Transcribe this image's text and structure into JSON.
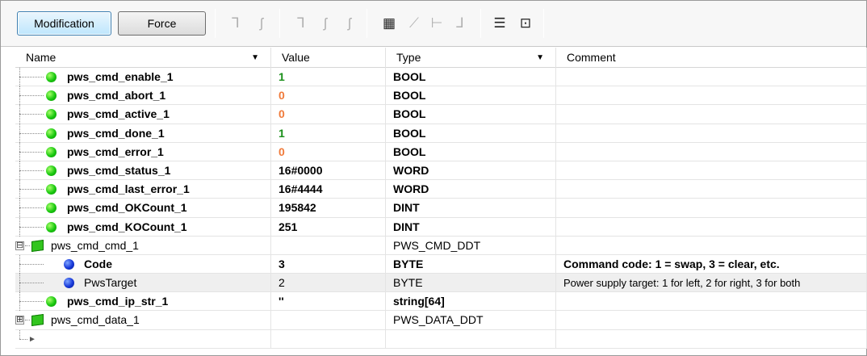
{
  "toolbar": {
    "modification_label": "Modification",
    "force_label": "Force"
  },
  "columns": {
    "name": "Name",
    "value": "Value",
    "type": "Type",
    "comment": "Comment"
  },
  "rows": [
    {
      "name": "pws_cmd_enable_1",
      "value": "1",
      "type": "BOOL",
      "comment": ""
    },
    {
      "name": "pws_cmd_abort_1",
      "value": "0",
      "type": "BOOL",
      "comment": ""
    },
    {
      "name": "pws_cmd_active_1",
      "value": "0",
      "type": "BOOL",
      "comment": ""
    },
    {
      "name": "pws_cmd_done_1",
      "value": "1",
      "type": "BOOL",
      "comment": ""
    },
    {
      "name": "pws_cmd_error_1",
      "value": "0",
      "type": "BOOL",
      "comment": ""
    },
    {
      "name": "pws_cmd_status_1",
      "value": "16#0000",
      "type": "WORD",
      "comment": ""
    },
    {
      "name": "pws_cmd_last_error_1",
      "value": "16#4444",
      "type": "WORD",
      "comment": ""
    },
    {
      "name": "pws_cmd_OKCount_1",
      "value": "195842",
      "type": "DINT",
      "comment": ""
    },
    {
      "name": "pws_cmd_KOCount_1",
      "value": "251",
      "type": "DINT",
      "comment": ""
    },
    {
      "name": "pws_cmd_cmd_1",
      "value": "",
      "type": "PWS_CMD_DDT",
      "comment": "",
      "expander": "⊟"
    },
    {
      "name": "Code",
      "value": "3",
      "type": "BYTE",
      "comment": "Command code: 1 = swap, 3 = clear, etc."
    },
    {
      "name": "PwsTarget",
      "value": "2",
      "type": "BYTE",
      "comment": "Power supply target: 1 for left, 2 for right, 3 for both"
    },
    {
      "name": "pws_cmd_ip_str_1",
      "value": "''",
      "type": "string[64]",
      "comment": ""
    },
    {
      "name": "pws_cmd_data_1",
      "value": "",
      "type": "PWS_DATA_DDT",
      "comment": "",
      "expander": "⊞"
    },
    {
      "name": "",
      "value": "",
      "type": "",
      "comment": "",
      "pointer": "►"
    }
  ],
  "colors": {
    "value_true": "#1a8f1a",
    "value_false": "#f07a3a",
    "selected_row": "#efefef"
  }
}
